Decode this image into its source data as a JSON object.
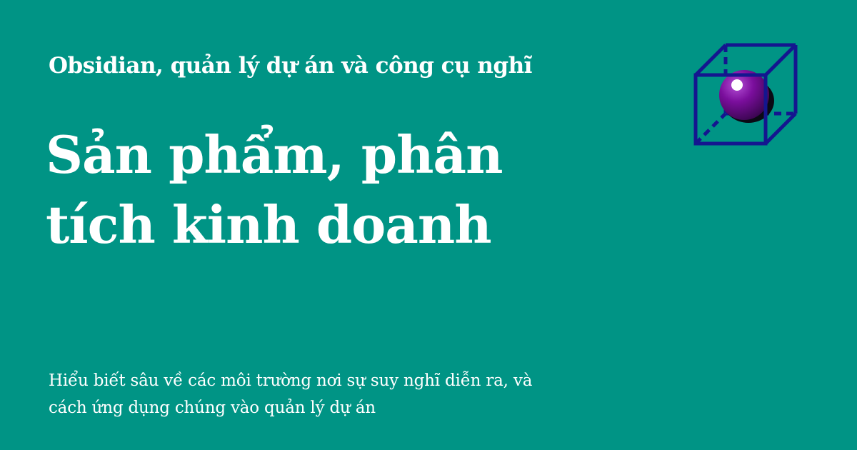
{
  "header": {
    "eyebrow": "Obsidian, quản lý dự án và công cụ nghĩ"
  },
  "main": {
    "title_lines": [
      "Sản phẩm, phân",
      "tích kinh doanh"
    ]
  },
  "footer": {
    "description_lines": [
      "Hiểu biết sâu về các môi trường nơi sự suy nghĩ diễn ra, và",
      "cách ứng dụng chúng vào quản lý dự án"
    ]
  },
  "logo": {
    "icon": "cube-with-sphere-icon"
  },
  "colors": {
    "background": "#009485",
    "text": "#ffffff",
    "cube_stroke": "#14168f",
    "sphere": "#7a0e9c"
  }
}
